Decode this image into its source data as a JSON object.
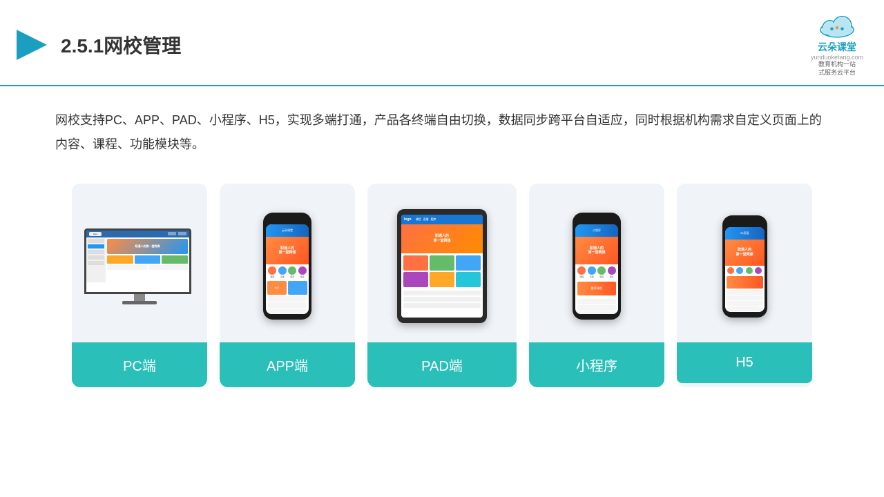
{
  "header": {
    "title": "2.5.1网校管理",
    "logo_brand": "云朵课堂",
    "logo_url": "yunduoketang.com",
    "logo_tagline": "教育机构一站\n式服务云平台"
  },
  "description": {
    "text": "网校支持PC、APP、PAD、小程序、H5，实现多端打通，产品各终端自由切换，数据同步跨平台自适应，同时根据机构需求自定义页面上的内容、课程、功能模块等。"
  },
  "cards": [
    {
      "id": "pc",
      "label": "PC端"
    },
    {
      "id": "app",
      "label": "APP端"
    },
    {
      "id": "pad",
      "label": "PAD端"
    },
    {
      "id": "miniapp",
      "label": "小程序"
    },
    {
      "id": "h5",
      "label": "H5"
    }
  ]
}
